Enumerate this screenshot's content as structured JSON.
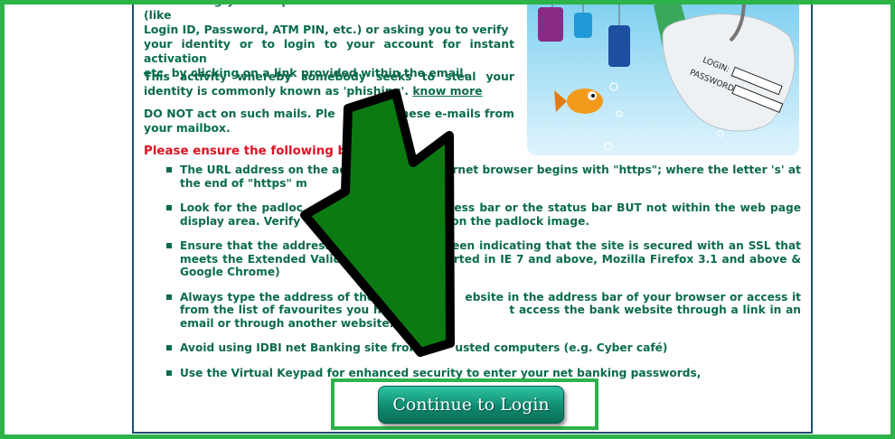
{
  "content": {
    "intro_line1": "Bank asking you to update sensitive account information (like",
    "intro_line2": "Login ID, Password, ATM PIN, etc.) or asking you to verify",
    "intro_line3": "your identity or to login to your account for instant activation",
    "intro_line4": "etc. by clicking on a link provided within the email.",
    "para2_text": "This activity whereby somebody seeks to steal your identity is commonly known as 'phishing'.",
    "know_more_link": "know more",
    "para3_text": "DO NOT act on such mails. Ple",
    "para3_text_b": "these e-mails from your mailbox.",
    "heading": "Please ensure the following b"
  },
  "tips": [
    "The URL address on the ad                         ernet browser begins with \"https\"; where the letter 's' at the end of \"https\" m",
    "Look for the padloc                            ddress bar or the status bar BUT not within the web page display area. Verify                          clicking on the padlock image.",
    "Ensure that the address                           een indicating that the site is secured with an SSL that meets the Extended Valid                        orted in IE 7 and above, Mozilla Firefox 3.1 and above & Google Chrome)",
    "Always type the address of the                      ebsite in the address bar of your browser or access it from the list of favourites you have s                      t access the bank website through a link in an email or through another website.",
    "Avoid using IDBI net Banking site from         usted computers (e.g. Cyber café)",
    "Use the Virtual Keypad for enhanced security to enter your net banking passwords,"
  ],
  "illustration": {
    "login_label": "LOGIN:",
    "password_label": "PASSWORD:"
  },
  "login_button": {
    "label": "Continue to Login"
  },
  "colors": {
    "frame": "#2db34a",
    "arrow": "#0c7a12",
    "text": "#0b6b4c",
    "heading": "#e01020"
  }
}
